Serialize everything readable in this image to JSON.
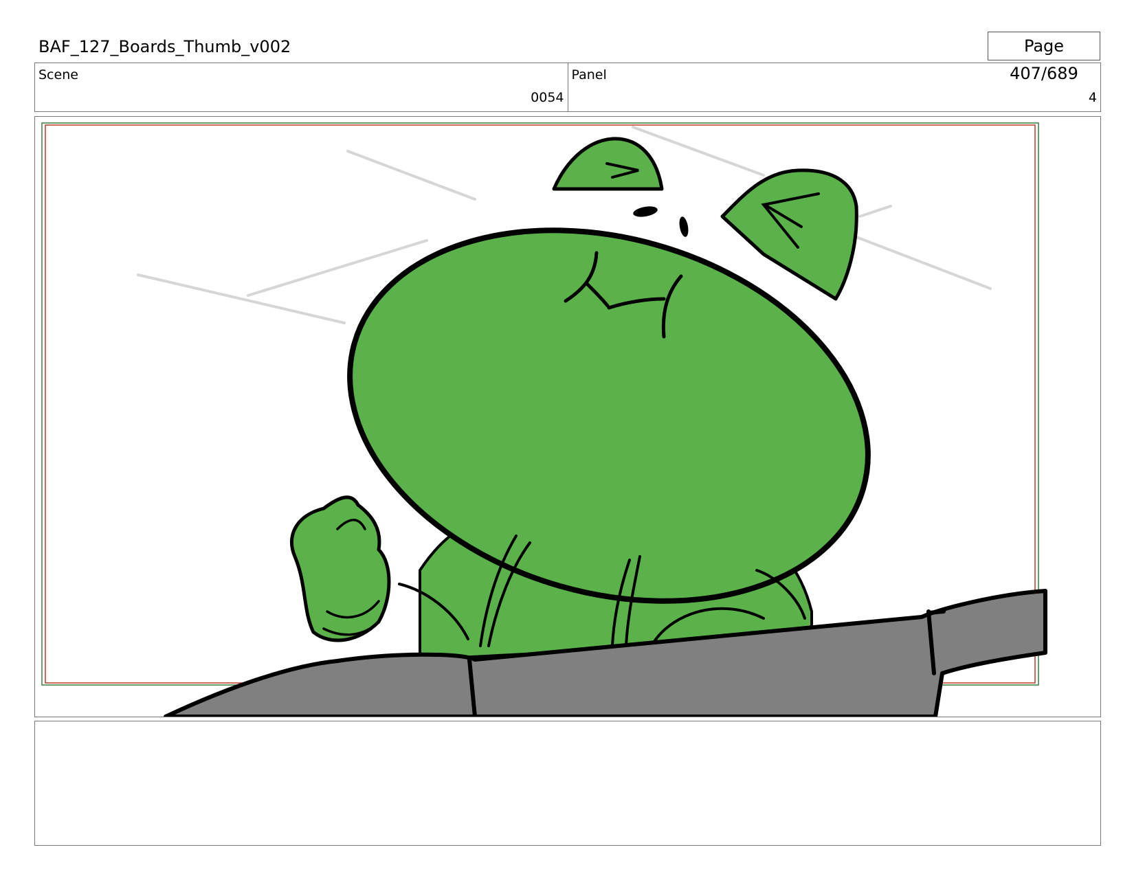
{
  "header": {
    "title": "BAF_127_Boards_Thumb_v002",
    "page": "Page 407/689"
  },
  "info": {
    "scene_label": "Scene",
    "scene_value": "0054",
    "panel_label": "Panel",
    "panel_value": "4"
  },
  "colors": {
    "character_green": "#5bb14a",
    "car_gray": "#808080",
    "safe_frame_red": "#c0392b",
    "safe_frame_green": "#3a7d44"
  },
  "notes": {
    "text": ""
  }
}
